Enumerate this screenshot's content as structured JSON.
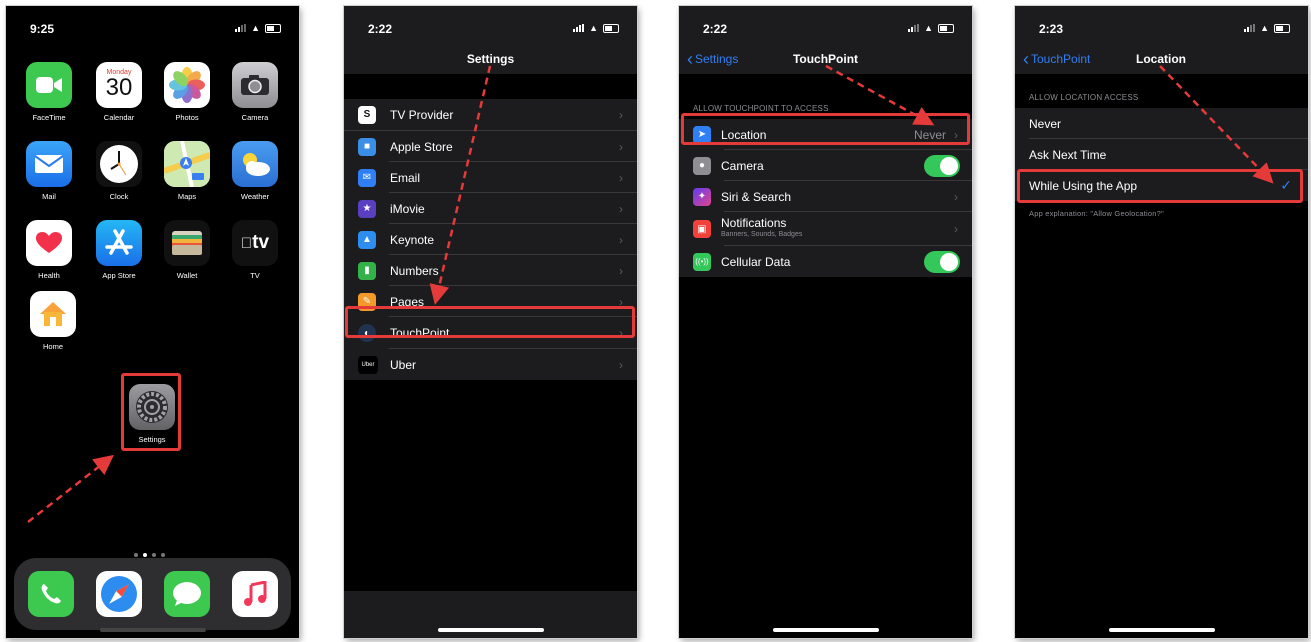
{
  "screen1": {
    "time": "9:25",
    "calendar_day": "Monday",
    "calendar_date": "30",
    "apps": [
      "FaceTime",
      "Calendar",
      "Photos",
      "Camera",
      "Mail",
      "Clock",
      "Maps",
      "Weather",
      "Health",
      "App Store",
      "Wallet",
      "TV",
      "Home"
    ],
    "settings_label": "Settings",
    "tv_logo": "tv"
  },
  "screen2": {
    "time": "2:22",
    "title": "Settings",
    "items": [
      "TV Provider",
      "Apple Store",
      "Email",
      "iMovie",
      "Keynote",
      "Numbers",
      "Pages",
      "TouchPoint",
      "Uber"
    ],
    "uber_icon_text": "Uber"
  },
  "screen3": {
    "time": "2:22",
    "back": "Settings",
    "title": "TouchPoint",
    "section": "ALLOW TOUCHPOINT TO ACCESS",
    "location": "Location",
    "location_value": "Never",
    "camera": "Camera",
    "siri": "Siri & Search",
    "notifications": "Notifications",
    "notifications_sub": "Banners, Sounds, Badges",
    "cellular": "Cellular Data"
  },
  "screen4": {
    "time": "2:23",
    "back": "TouchPoint",
    "title": "Location",
    "section": "ALLOW LOCATION ACCESS",
    "options": [
      "Never",
      "Ask Next Time",
      "While Using the App"
    ],
    "explanation": "App explanation: \"Allow Geolocation?\""
  },
  "colors": {
    "highlight": "#e43a3a",
    "ios_blue": "#2f7ff6",
    "toggle_on": "#34c759"
  }
}
